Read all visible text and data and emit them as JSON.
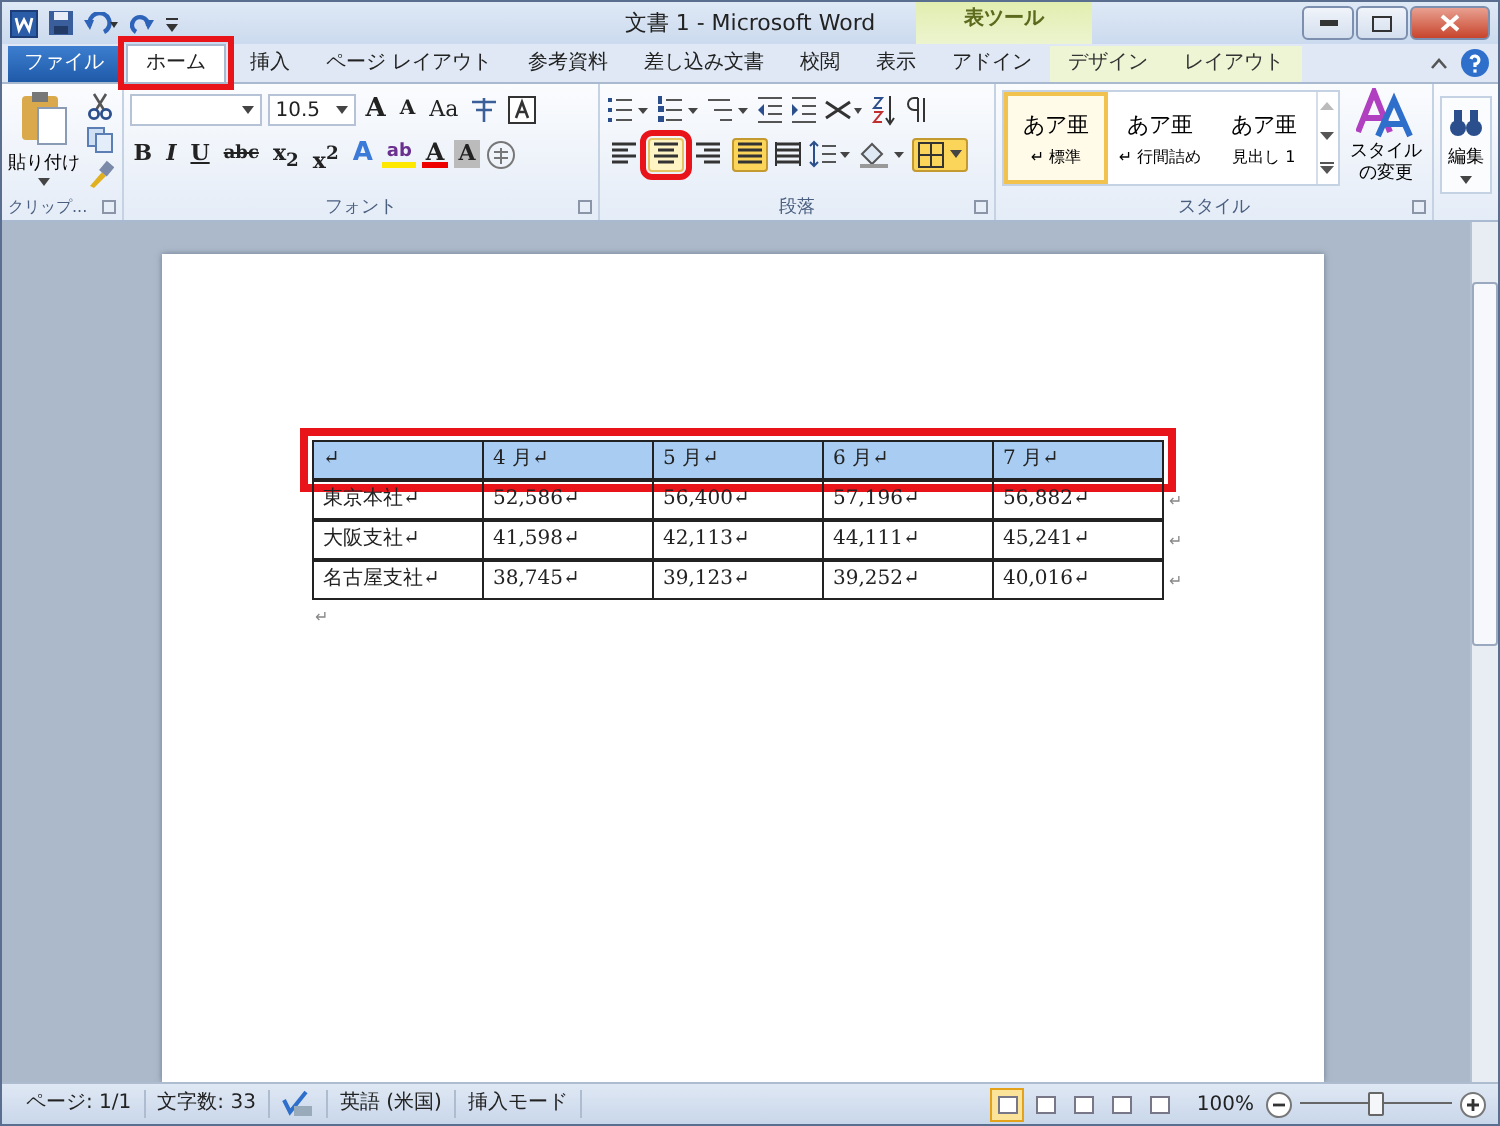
{
  "window": {
    "title": "文書 1 - Microsoft Word",
    "context_group": "表ツール"
  },
  "tabs": [
    {
      "label": "ファイル",
      "kind": "file",
      "selected": false,
      "highlight": false
    },
    {
      "label": "ホーム",
      "kind": "tab",
      "selected": true,
      "highlight": true
    },
    {
      "label": "挿入",
      "kind": "tab",
      "selected": false,
      "highlight": false
    },
    {
      "label": "ページ レイアウト",
      "kind": "tab",
      "selected": false,
      "highlight": false
    },
    {
      "label": "参考資料",
      "kind": "tab",
      "selected": false,
      "highlight": false
    },
    {
      "label": "差し込み文書",
      "kind": "tab",
      "selected": false,
      "highlight": false
    },
    {
      "label": "校閲",
      "kind": "tab",
      "selected": false,
      "highlight": false
    },
    {
      "label": "表示",
      "kind": "tab",
      "selected": false,
      "highlight": false
    },
    {
      "label": "アドイン",
      "kind": "tab",
      "selected": false,
      "highlight": false
    },
    {
      "label": "デザイン",
      "kind": "context",
      "selected": false,
      "highlight": false
    },
    {
      "label": "レイアウト",
      "kind": "context",
      "selected": false,
      "highlight": false
    }
  ],
  "clipboard": {
    "paste": "貼り付け",
    "group": "クリップ..."
  },
  "font": {
    "size": "10.5",
    "grow": "A",
    "shrink": "A",
    "case": "Aa",
    "bold": "B",
    "italic": "I",
    "underline": "U",
    "strike": "abc",
    "sub": "x$_{2}$",
    "sup": "x$^{2}$",
    "effects": "A",
    "highlight": "ab",
    "font_color_label": "A",
    "shade": "A",
    "group": "フォント"
  },
  "paragraph": {
    "group": "段落",
    "align": [
      {
        "selected": false,
        "hover": false,
        "highlight": false
      },
      {
        "selected": false,
        "hover": true,
        "highlight": true
      },
      {
        "selected": false,
        "hover": false,
        "highlight": false
      },
      {
        "selected": true,
        "hover": false,
        "highlight": false
      }
    ],
    "borders_selected": true
  },
  "styles": {
    "group": "スタイル",
    "items": [
      {
        "sample": "あア亜",
        "name": "↵ 標準",
        "selected": true
      },
      {
        "sample": "あア亜",
        "name": "↵ 行間詰め",
        "selected": false
      },
      {
        "sample": "あア亜",
        "name": "見出し 1",
        "selected": false
      }
    ],
    "change": "スタイルの変更"
  },
  "editing": {
    "label": "編集"
  },
  "table": {
    "rows": [
      {
        "selected": true,
        "highlight": true,
        "cells": [
          "↵",
          "4 月↵",
          "5 月↵",
          "6 月↵",
          "7 月↵"
        ],
        "end": ""
      },
      {
        "selected": false,
        "highlight": false,
        "cells": [
          "東京本社↵",
          "52,586↵",
          "56,400↵",
          "57,196↵",
          "56,882↵"
        ],
        "end": "↵"
      },
      {
        "selected": false,
        "highlight": false,
        "cells": [
          "大阪支社↵",
          "41,598↵",
          "42,113↵",
          "44,111↵",
          "45,241↵"
        ],
        "end": "↵"
      },
      {
        "selected": false,
        "highlight": false,
        "cells": [
          "名古屋支社↵",
          "38,745↵",
          "39,123↵",
          "39,252↵",
          "40,016↵"
        ],
        "end": "↵"
      }
    ],
    "after": "↵"
  },
  "status_bar": {
    "page": "ページ: 1/1",
    "words": "文字数: 33",
    "language": "英語 (米国)",
    "mode": "挿入モード",
    "views": [
      {
        "selected": true
      },
      {
        "selected": false
      },
      {
        "selected": false
      },
      {
        "selected": false
      },
      {
        "selected": false
      }
    ],
    "zoom": "100%",
    "level": 0.5
  }
}
